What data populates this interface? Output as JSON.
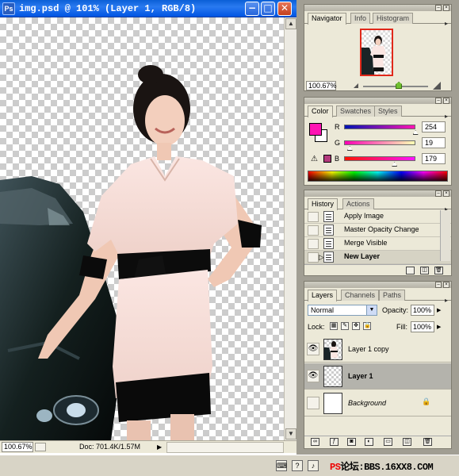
{
  "document": {
    "title": "img.psd @ 101% (Layer 1, RGB/8)",
    "app_icon": "Ps",
    "buttons": {
      "minimize": "−",
      "maximize": "□",
      "close": "✕"
    },
    "status": {
      "zoom": "100.67%",
      "doc_info": "Doc: 701.4K/1.57M"
    }
  },
  "navigator": {
    "tabs": [
      "Navigator",
      "Info",
      "Histogram"
    ],
    "zoom": "100.67%",
    "zoom_slider_fraction": 0.55
  },
  "color": {
    "tabs": [
      "Color",
      "Swatches",
      "Styles"
    ],
    "foreground": "#fe13b3",
    "background": "#ffffff",
    "channels": [
      {
        "label": "R",
        "value": "254",
        "fraction": 0.996
      },
      {
        "label": "G",
        "value": "19",
        "fraction": 0.075
      },
      {
        "label": "B",
        "value": "179",
        "fraction": 0.702
      }
    ],
    "gamut_warning_color": "#b33a7d"
  },
  "history": {
    "tabs": [
      "History",
      "Actions"
    ],
    "items": [
      {
        "label": "Apply Image",
        "selected": false
      },
      {
        "label": "Master Opacity Change",
        "selected": false
      },
      {
        "label": "Merge Visible",
        "selected": false
      },
      {
        "label": "New Layer",
        "selected": true
      }
    ]
  },
  "layers": {
    "tabs": [
      "Layers",
      "Channels",
      "Paths"
    ],
    "blend_mode": "Normal",
    "opacity_label": "Opacity:",
    "opacity": "100%",
    "lock_label": "Lock:",
    "fill_label": "Fill:",
    "fill": "100%",
    "items": [
      {
        "name": "Layer 1 copy",
        "visible": true,
        "selected": false
      },
      {
        "name": "Layer 1",
        "visible": true,
        "selected": true
      },
      {
        "name": "Background",
        "visible": false,
        "selected": false,
        "locked": true
      }
    ]
  },
  "taskbar": {
    "watermark_ps": "PS",
    "watermark_text": "论坛:BBS.16XX8.COM"
  }
}
